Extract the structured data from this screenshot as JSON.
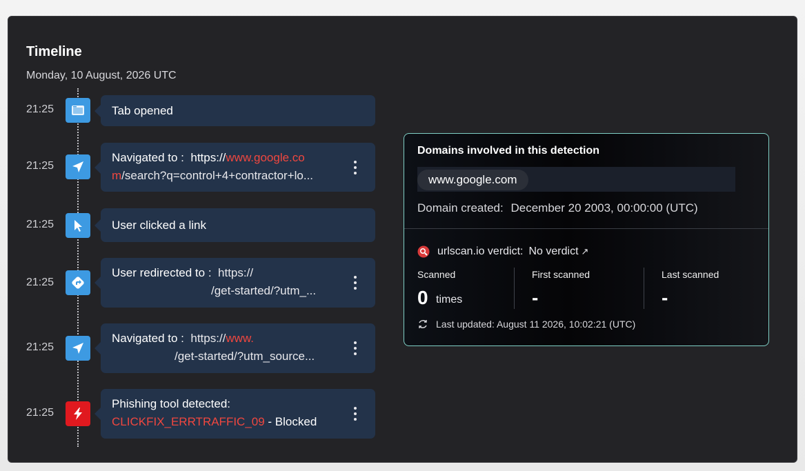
{
  "timeline": {
    "title": "Timeline",
    "date": "Monday, 10 August, 2026 UTC",
    "events": [
      {
        "time": "21:25",
        "icon": "browser-tab-icon",
        "text": "Tab opened"
      },
      {
        "time": "21:25",
        "icon": "navigate-arrow-icon",
        "prefix": "Navigated to :",
        "url_start": "https://",
        "url_domain_a": "www.google.co",
        "url_domain_b": "m",
        "url_path": "/search?q=control+4+contractor+lo..."
      },
      {
        "time": "21:25",
        "icon": "cursor-click-icon",
        "text": "User clicked a link"
      },
      {
        "time": "21:25",
        "icon": "redirect-icon",
        "prefix": "User redirected to :",
        "url_start": "https://",
        "url_path": "/get-started/?utm_..."
      },
      {
        "time": "21:25",
        "icon": "navigate-arrow-icon",
        "prefix": "Navigated to :",
        "url_start": "https://",
        "url_domain_a": "www.",
        "url_path": "/get-started/?utm_source..."
      },
      {
        "time": "21:25",
        "icon": "lightning-icon",
        "prefix": "Phishing tool detected:",
        "tool": "CLICKFIX_ERRTRAFFIC_09",
        "suffix": " - Blocked"
      }
    ]
  },
  "domains": {
    "heading": "Domains involved in this detection",
    "domain": "www.google.com",
    "created_label": "Domain created:",
    "created_value": "December 20 2003, 00:00:00 (UTC)",
    "verdict_label": "urlscan.io verdict:",
    "verdict_value": "No verdict",
    "verdict_arrow": "↗",
    "scanned_label": "Scanned",
    "scanned_value": "0",
    "scanned_unit": "times",
    "first_label": "First scanned",
    "first_value": "-",
    "last_label": "Last scanned",
    "last_value": "-",
    "updated": "Last updated: August 11 2026, 10:02:21 (UTC)"
  },
  "colors": {
    "accent_blue": "#3d9ae2",
    "alert_red": "#e0191f",
    "link_red": "#f0473f",
    "card": "#23334a"
  }
}
